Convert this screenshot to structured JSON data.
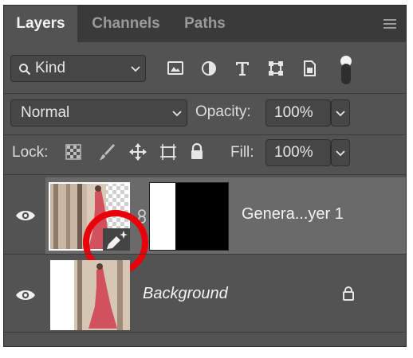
{
  "tabs": [
    {
      "label": "Layers",
      "active": true
    },
    {
      "label": "Channels",
      "active": false
    },
    {
      "label": "Paths",
      "active": false
    }
  ],
  "filter": {
    "kind_label": "Kind",
    "icons": [
      "image-filter-icon",
      "adjustment-filter-icon",
      "type-filter-icon",
      "shape-filter-icon",
      "smart-object-filter-icon",
      "filter-toggle"
    ]
  },
  "blend": {
    "mode": "Normal",
    "opacity_label": "Opacity:",
    "opacity_value": "100%"
  },
  "lock": {
    "label": "Lock:",
    "fill_label": "Fill:",
    "fill_value": "100%"
  },
  "layers": [
    {
      "name": "Genera...yer 1",
      "selected": true,
      "visible": true,
      "italic": false,
      "locked": false
    },
    {
      "name": "Background",
      "selected": false,
      "visible": true,
      "italic": true,
      "locked": true
    }
  ],
  "colors": {
    "panel": "#535353",
    "tabbar": "#3a3a3a",
    "selected_layer": "#6a6a6a",
    "highlight_circle": "#e8000b"
  }
}
